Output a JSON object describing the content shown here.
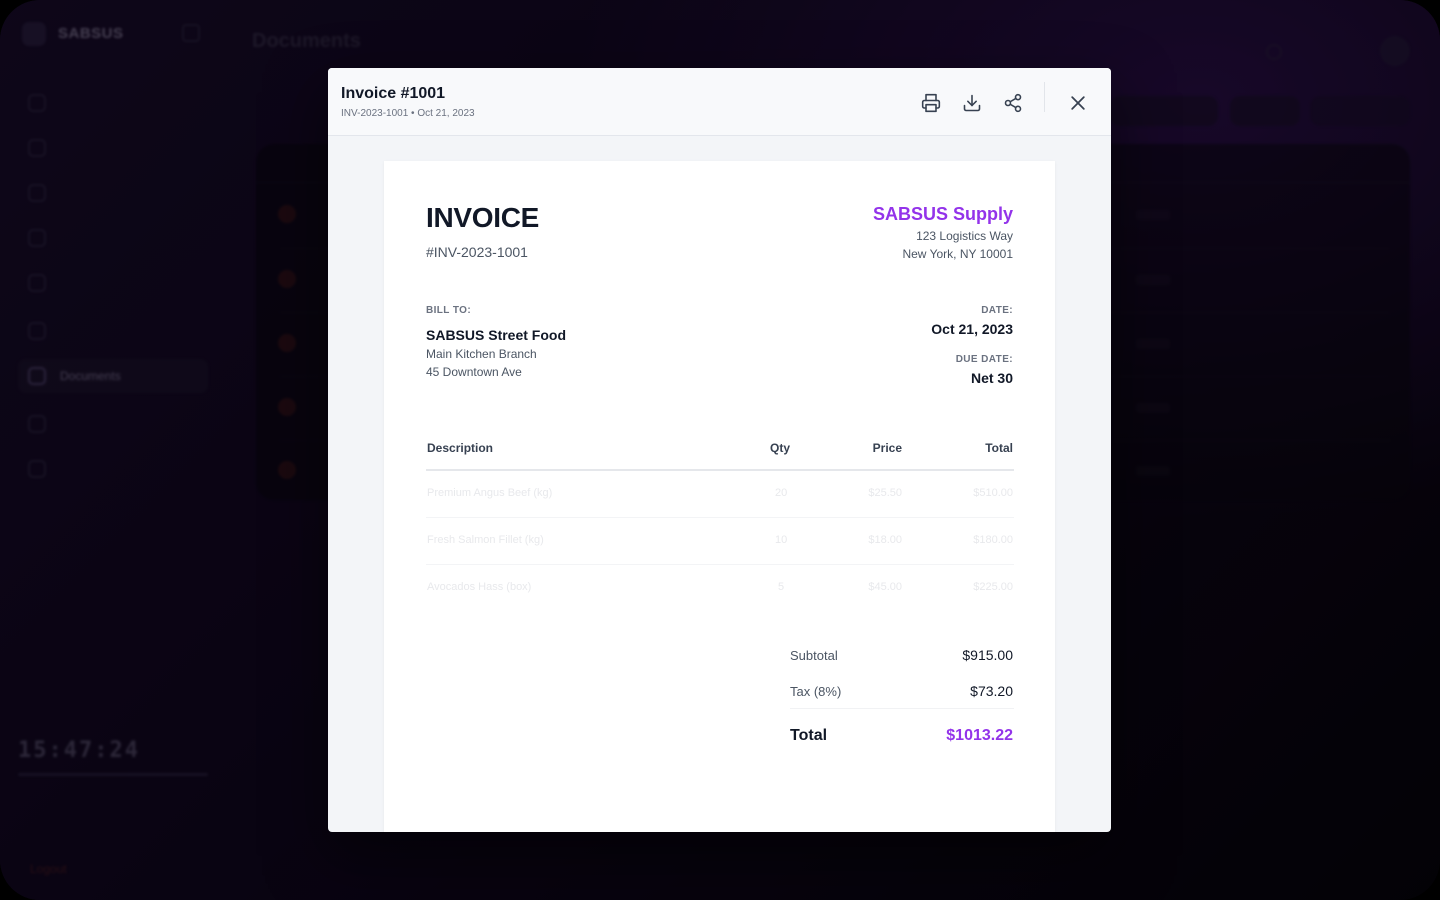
{
  "modal": {
    "title": "Invoice #1001",
    "subtitle": "INV-2023-1001 • Oct 21, 2023",
    "actions": {
      "print_icon": "printer-icon",
      "download_icon": "download-icon",
      "share_icon": "share-icon",
      "close_icon": "close-icon"
    }
  },
  "invoice": {
    "heading": "INVOICE",
    "number": "#INV-2023-1001",
    "company": {
      "name": "SABSUS Supply",
      "address_line1": "123 Logistics Way",
      "address_line2": "New York, NY 10001"
    },
    "bill_to": {
      "label": "BILL TO:",
      "name": "SABSUS Street Food",
      "line1": "Main Kitchen Branch",
      "line2": "45 Downtown Ave"
    },
    "date": {
      "label": "DATE:",
      "value": "Oct 21, 2023"
    },
    "due_date": {
      "label": "DUE DATE:",
      "value": "Net 30"
    },
    "table": {
      "headers": {
        "description": "Description",
        "qty": "Qty",
        "price": "Price",
        "total": "Total"
      },
      "rows": [
        {
          "description": "Premium Angus Beef (kg)",
          "qty": "20",
          "price": "$25.50",
          "total": "$510.00"
        },
        {
          "description": "Fresh Salmon Fillet (kg)",
          "qty": "10",
          "price": "$18.00",
          "total": "$180.00"
        },
        {
          "description": "Avocados Hass (box)",
          "qty": "5",
          "price": "$45.00",
          "total": "$225.00"
        }
      ]
    },
    "summary": {
      "subtotal_label": "Subtotal",
      "subtotal_value": "$915.00",
      "tax_label": "Tax (8%)",
      "tax_value": "$73.20",
      "total_label": "Total",
      "total_value": "$1013.22"
    }
  },
  "background": {
    "sidebar": {
      "brand": "SABSUS",
      "clock": "15:47:24",
      "active_item": "Documents",
      "logout": "Logout"
    },
    "page_title": "Documents",
    "accent_color": "#9333ea"
  }
}
